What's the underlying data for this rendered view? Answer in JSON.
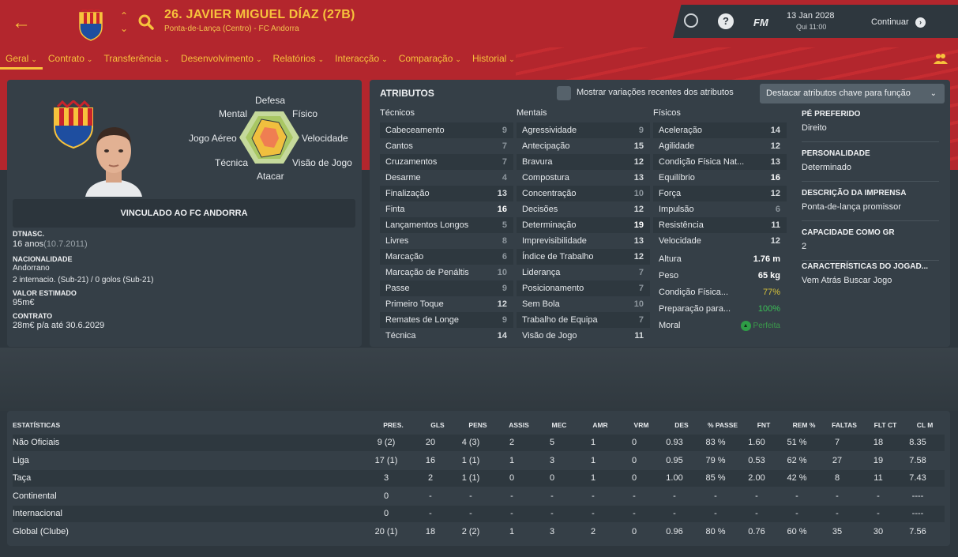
{
  "header": {
    "player_name": "26. JAVIER MIGUEL DÍAZ (27B)",
    "subtitle": "Ponta-de-Lança (Centro) - FC Andorra",
    "date": "13 Jan 2028",
    "time": "Qui 11:00",
    "continue_label": "Continuar",
    "fm_label": "FM",
    "help_label": "?"
  },
  "tabs": [
    "Geral",
    "Contrato",
    "Transferência",
    "Desenvolvimento",
    "Relatórios",
    "Interacção",
    "Comparação",
    "Historial"
  ],
  "radar_labels": {
    "top": "Defesa",
    "top_left": "Mental",
    "top_right": "Físico",
    "left": "Jogo Aéreo",
    "right": "Velocidade",
    "bottom_left": "Técnica",
    "bottom_right": "Visão de Jogo",
    "bottom": "Atacar"
  },
  "profile": {
    "banner": "VINCULADO AO FC ANDORRA",
    "dob_label": "DTNASC.",
    "dob_age": "16 anos",
    "dob_date": "(10.7.2011)",
    "nationality_label": "NACIONALIDADE",
    "nationality": "Andorrano",
    "caps": "2 internacio. (Sub-21) / 0 golos (Sub-21)",
    "value_label": "VALOR ESTIMADO",
    "value": "95m€",
    "contract_label": "CONTRATO",
    "contract": "28m€ p/a até 30.6.2029"
  },
  "attributes": {
    "title": "ATRIBUTOS",
    "toggle_label": "Mostrar variações recentes dos atributos",
    "dropdown_label": "Destacar atributos chave para função",
    "tech_header": "Técnicos",
    "mental_header": "Mentais",
    "physical_header": "Físicos",
    "technical": [
      {
        "name": "Cabeceamento",
        "value": "9"
      },
      {
        "name": "Cantos",
        "value": "7"
      },
      {
        "name": "Cruzamentos",
        "value": "7"
      },
      {
        "name": "Desarme",
        "value": "4"
      },
      {
        "name": "Finalização",
        "value": "13"
      },
      {
        "name": "Finta",
        "value": "16"
      },
      {
        "name": "Lançamentos Longos",
        "value": "5"
      },
      {
        "name": "Livres",
        "value": "8"
      },
      {
        "name": "Marcação",
        "value": "6"
      },
      {
        "name": "Marcação de Penáltis",
        "value": "10"
      },
      {
        "name": "Passe",
        "value": "9"
      },
      {
        "name": "Primeiro Toque",
        "value": "12"
      },
      {
        "name": "Remates de Longe",
        "value": "9"
      },
      {
        "name": "Técnica",
        "value": "14"
      }
    ],
    "mental": [
      {
        "name": "Agressividade",
        "value": "9"
      },
      {
        "name": "Antecipação",
        "value": "15"
      },
      {
        "name": "Bravura",
        "value": "12"
      },
      {
        "name": "Compostura",
        "value": "13"
      },
      {
        "name": "Concentração",
        "value": "10"
      },
      {
        "name": "Decisões",
        "value": "12"
      },
      {
        "name": "Determinação",
        "value": "19"
      },
      {
        "name": "Imprevisibilidade",
        "value": "13"
      },
      {
        "name": "Índice de Trabalho",
        "value": "12"
      },
      {
        "name": "Liderança",
        "value": "7"
      },
      {
        "name": "Posicionamento",
        "value": "7"
      },
      {
        "name": "Sem Bola",
        "value": "10"
      },
      {
        "name": "Trabalho de Equipa",
        "value": "7"
      },
      {
        "name": "Visão de Jogo",
        "value": "11"
      }
    ],
    "physical": [
      {
        "name": "Aceleração",
        "value": "14"
      },
      {
        "name": "Agilidade",
        "value": "12"
      },
      {
        "name": "Condição Física Nat...",
        "value": "13"
      },
      {
        "name": "Equilíbrio",
        "value": "16"
      },
      {
        "name": "Força",
        "value": "12"
      },
      {
        "name": "Impulsão",
        "value": "6"
      },
      {
        "name": "Resistência",
        "value": "11"
      },
      {
        "name": "Velocidade",
        "value": "12"
      }
    ],
    "extra": {
      "height_label": "Altura",
      "height": "1.76 m",
      "weight_label": "Peso",
      "weight": "65 kg",
      "condition_label": "Condição Física...",
      "condition": "77%",
      "prep_label": "Preparação para...",
      "prep": "100%",
      "moral_label": "Moral",
      "moral": "Perfeita"
    }
  },
  "side_info": [
    {
      "label": "PÉ PREFERIDO",
      "value": "Direito"
    },
    {
      "label": "PERSONALIDADE",
      "value": "Determinado"
    },
    {
      "label": "DESCRIÇÃO DA IMPRENSA",
      "value": "Ponta-de-lança promissor"
    },
    {
      "label": "CAPACIDADE COMO GR",
      "value": "2"
    },
    {
      "label": "CARACTERÍSTICAS DO JOGAD...",
      "value": "Vem Atrás Buscar Jogo"
    }
  ],
  "stats": {
    "title": "ESTATÍSTICAS",
    "columns": [
      "PRES.",
      "GLS",
      "PENS",
      "ASSIS",
      "MEC",
      "AMR",
      "VRM",
      "DES",
      "% PASSE",
      "FNT",
      "REM %",
      "FALTAS",
      "FLT CT",
      "CL M"
    ],
    "rows": [
      {
        "name": "Não Oficiais",
        "cells": [
          "9 (2)",
          "20",
          "4 (3)",
          "2",
          "5",
          "1",
          "0",
          "0.93",
          "83 %",
          "1.60",
          "51 %",
          "7",
          "18",
          "8.35"
        ]
      },
      {
        "name": "Liga",
        "cells": [
          "17 (1)",
          "16",
          "1 (1)",
          "1",
          "3",
          "1",
          "0",
          "0.95",
          "79 %",
          "0.53",
          "62 %",
          "27",
          "19",
          "7.58"
        ]
      },
      {
        "name": "Taça",
        "cells": [
          "3",
          "2",
          "1 (1)",
          "0",
          "0",
          "1",
          "0",
          "1.00",
          "85 %",
          "2.00",
          "42 %",
          "8",
          "11",
          "7.43"
        ]
      },
      {
        "name": "Continental",
        "cells": [
          "0",
          "-",
          "-",
          "-",
          "-",
          "-",
          "-",
          "-",
          "-",
          "-",
          "-",
          "-",
          "-",
          "----"
        ]
      },
      {
        "name": "Internacional",
        "cells": [
          "0",
          "-",
          "-",
          "-",
          "-",
          "-",
          "-",
          "-",
          "-",
          "-",
          "-",
          "-",
          "-",
          "----"
        ]
      },
      {
        "name": "Global (Clube)",
        "cells": [
          "20 (1)",
          "18",
          "2 (2)",
          "1",
          "3",
          "2",
          "0",
          "0.96",
          "80 %",
          "0.76",
          "60 %",
          "35",
          "30",
          "7.56"
        ]
      }
    ]
  },
  "colors": {
    "accent": "#f7c23c",
    "header_red": "#b3262d",
    "panel": "#353f47"
  }
}
